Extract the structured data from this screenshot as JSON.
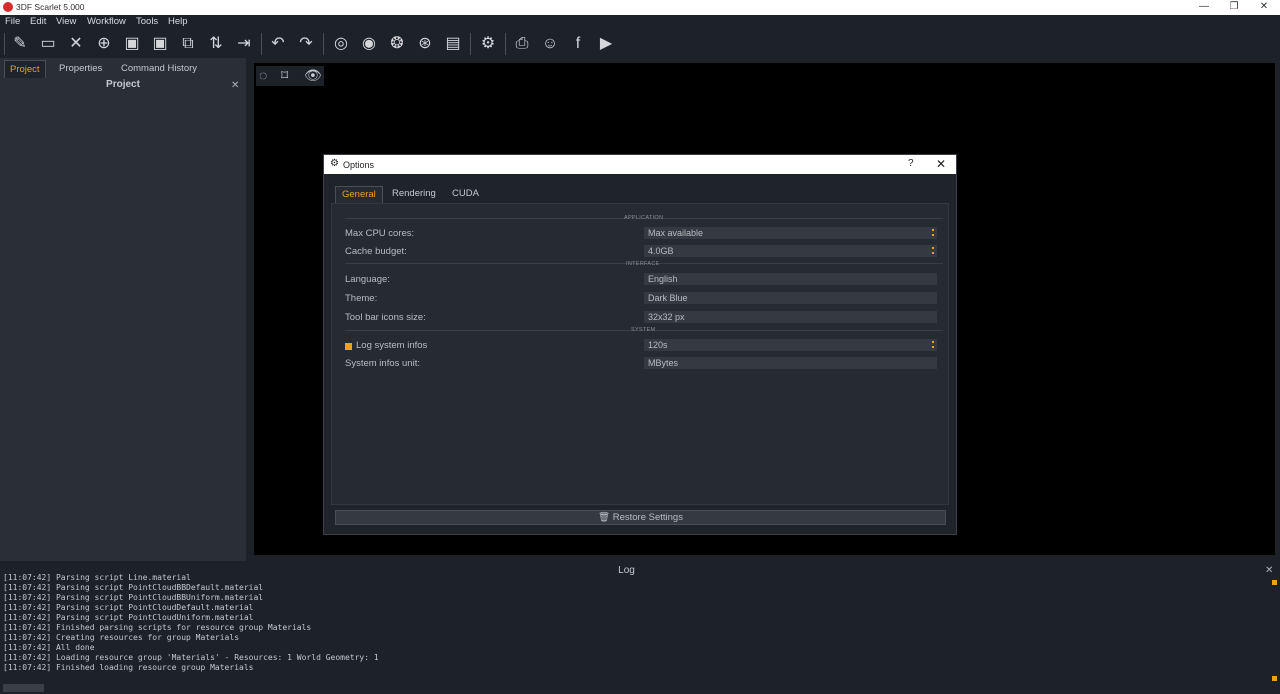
{
  "window": {
    "title": "3DF Scarlet 5.000"
  },
  "menu": [
    "File",
    "Edit",
    "View",
    "Workflow",
    "Tools",
    "Help"
  ],
  "toolbar_icons": [
    "new-icon",
    "open-icon",
    "close-icon",
    "add-icon",
    "save-icon",
    "save-as-icon",
    "duplicate-icon",
    "import-export-icon",
    "export-icon",
    "undo-icon",
    "redo-icon",
    "workflow-icon",
    "photo-icon",
    "cluster-icon",
    "help-circle-icon",
    "pdf-icon",
    "settings-icon",
    "manual-icon",
    "discord-icon",
    "facebook-icon",
    "youtube-icon"
  ],
  "left_tabs": [
    "Project",
    "Properties",
    "Command History"
  ],
  "project_panel": {
    "title": "Project"
  },
  "dialog": {
    "title": "Options",
    "help": "?",
    "tabs": [
      "General",
      "Rendering",
      "CUDA"
    ],
    "sections": {
      "application": "APPLICATION",
      "interface": "INTERFACE",
      "system": "SYSTEM"
    },
    "rows": {
      "max_cpu_label": "Max CPU cores:",
      "max_cpu_value": "Max available",
      "cache_label": "Cache budget:",
      "cache_value": "4.0GB",
      "language_label": "Language:",
      "language_value": "English",
      "theme_label": "Theme:",
      "theme_value": "Dark Blue",
      "toolbar_icons_label": "Tool bar icons size:",
      "toolbar_icons_value": "32x32 px",
      "log_system_label": "Log system infos",
      "log_system_value": "120s",
      "sys_unit_label": "System infos unit:",
      "sys_unit_value": "MBytes"
    },
    "restore_label": "Restore Settings"
  },
  "log": {
    "title": "Log",
    "lines": [
      "[11:07:42] Parsing script Line.material",
      "[11:07:42] Parsing script PointCloudBBDefault.material",
      "[11:07:42] Parsing script PointCloudBBUniform.material",
      "[11:07:42] Parsing script PointCloudDefault.material",
      "[11:07:42] Parsing script PointCloudUniform.material",
      "[11:07:42] Finished parsing scripts for resource group Materials",
      "[11:07:42] Creating resources for group Materials",
      "[11:07:42] All done",
      "[11:07:42] Loading resource group 'Materials' - Resources: 1 World Geometry: 1",
      "[11:07:42] Finished loading resource group Materials"
    ]
  },
  "colors": {
    "accent": "#e8a21b",
    "panel": "#2a2f37",
    "background": "#1d2128"
  }
}
